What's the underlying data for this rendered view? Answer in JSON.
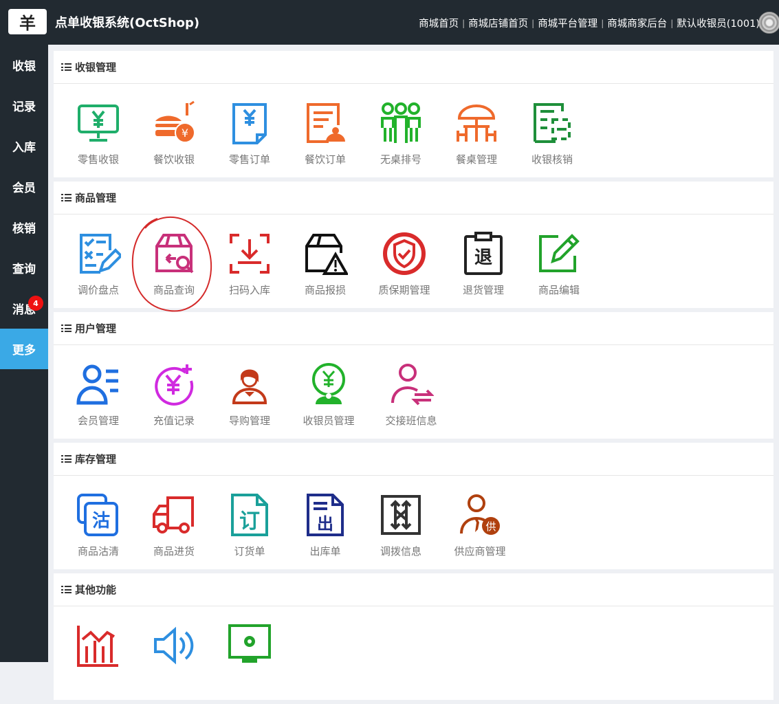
{
  "header": {
    "logo_text": "羊",
    "title": "点单收银系统(OctShop)",
    "links": [
      "商城首页",
      "商城店铺首页",
      "商城平台管理",
      "商城商家后台",
      "默认收银员(1001)"
    ]
  },
  "sidebar": {
    "items": [
      {
        "label": "收银"
      },
      {
        "label": "记录"
      },
      {
        "label": "入库"
      },
      {
        "label": "会员"
      },
      {
        "label": "核销"
      },
      {
        "label": "查询"
      },
      {
        "label": "消息",
        "badge": "4"
      },
      {
        "label": "更多",
        "active": true
      }
    ]
  },
  "sections": [
    {
      "title": "收银管理",
      "tiles": [
        {
          "label": "零售收银",
          "icon": "monitor-yuan-icon",
          "color": "#1fae6a"
        },
        {
          "label": "餐饮收银",
          "icon": "burger-yuan-icon",
          "color": "#ef6a2c"
        },
        {
          "label": "零售订单",
          "icon": "document-yuan-icon",
          "color": "#2e8fe0"
        },
        {
          "label": "餐饮订单",
          "icon": "order-chef-icon",
          "color": "#ef6a2c"
        },
        {
          "label": "无桌排号",
          "icon": "people-queue-icon",
          "color": "#22b22b"
        },
        {
          "label": "餐桌管理",
          "icon": "table-umbrella-icon",
          "color": "#ef6a2c"
        },
        {
          "label": "收银核销",
          "icon": "scan-verify-icon",
          "color": "#1e8f3a"
        }
      ]
    },
    {
      "title": "商品管理",
      "tiles": [
        {
          "label": "调价盘点",
          "icon": "checklist-edit-icon",
          "color": "#2e8fe0"
        },
        {
          "label": "商品查询",
          "icon": "box-search-icon",
          "color": "#c8307a"
        },
        {
          "label": "扫码入库",
          "icon": "scan-download-icon",
          "color": "#d92b2b"
        },
        {
          "label": "商品报损",
          "icon": "box-warning-icon",
          "color": "#111111"
        },
        {
          "label": "质保期管理",
          "icon": "shield-check-icon",
          "color": "#d92b2b"
        },
        {
          "label": "退货管理",
          "icon": "clipboard-return-icon",
          "color": "#222222",
          "glyph": "退"
        },
        {
          "label": "商品编辑",
          "icon": "edit-square-icon",
          "color": "#22a32b"
        }
      ]
    },
    {
      "title": "用户管理",
      "tiles": [
        {
          "label": "会员管理",
          "icon": "member-list-icon",
          "color": "#1f6fe0"
        },
        {
          "label": "充值记录",
          "icon": "recharge-yuan-icon",
          "color": "#d02ae0"
        },
        {
          "label": "导购管理",
          "icon": "shop-assistant-icon",
          "color": "#c33a1a"
        },
        {
          "label": "收银员管理",
          "icon": "cashier-avatar-icon",
          "color": "#22b22b"
        },
        {
          "label": "交接班信息",
          "icon": "user-exchange-icon",
          "color": "#c8307a"
        }
      ]
    },
    {
      "title": "库存管理",
      "tiles": [
        {
          "label": "商品沽清",
          "icon": "sold-out-icon",
          "color": "#1f6fe0",
          "glyph": "沽"
        },
        {
          "label": "商品进货",
          "icon": "truck-icon",
          "color": "#d92b2b"
        },
        {
          "label": "订货单",
          "icon": "order-form-icon",
          "color": "#1aa09a",
          "glyph": "订"
        },
        {
          "label": "出库单",
          "icon": "outbound-doc-icon",
          "color": "#1e2d8a",
          "glyph": "出"
        },
        {
          "label": "调拨信息",
          "icon": "transfer-arrows-icon",
          "color": "#333333"
        },
        {
          "label": "供应商管理",
          "icon": "supplier-icon",
          "color": "#b0400e",
          "glyph": "供"
        }
      ]
    },
    {
      "title": "其他功能",
      "tiles": [
        {
          "label": "",
          "icon": "bar-chart-icon",
          "color": "#d92b2b"
        },
        {
          "label": "",
          "icon": "speaker-icon",
          "color": "#2e8fe0"
        },
        {
          "label": "",
          "icon": "monitor-settings-icon",
          "color": "#22a32b"
        }
      ]
    }
  ]
}
